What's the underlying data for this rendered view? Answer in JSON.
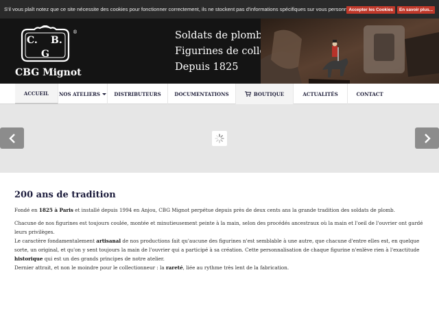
{
  "cookie": {
    "message": "S'il vous plaît notez que ce site nécessite des cookies pour fonctionner correctement, ils ne stockent pas d'informations spécifiques sur vous personnellement",
    "accept_label": "Accepter les Cookies",
    "more_label": "En savoir plus..."
  },
  "header": {
    "logo_letters": [
      "C.",
      "B.",
      "G"
    ],
    "logo_name": "CBG Mignot",
    "tagline": [
      "Soldats de plomb,",
      "Figurines de collection",
      "Depuis 1825"
    ]
  },
  "nav": {
    "items": [
      {
        "label": "Accueil"
      },
      {
        "label": "Nos ateliers"
      },
      {
        "label": "Distributeurs"
      },
      {
        "label": "Documentations"
      },
      {
        "label": "Boutique"
      },
      {
        "label": "Actualités"
      },
      {
        "label": "Contact"
      }
    ],
    "active_index": 0
  },
  "slider": {
    "prev_icon": "chevron-left-icon",
    "next_icon": "chevron-right-icon",
    "loading_icon": "spinner-icon"
  },
  "content": {
    "heading": "200 ans de tradition",
    "p1": {
      "a": "Fondé en ",
      "b": "1825 à Paris",
      "c": " et installé depuis 1994 en Anjou, CBG Mignot perpétue depuis près de deux cents ans la grande tradition des soldats de plomb."
    },
    "p2": "Chacune de nos figurines est toujours coulée, montée et minutieusement peinte à la main, selon des procédés ancestraux où la main et l'oeil de l'ouvrier ont gardé leurs privilèges.",
    "p3": {
      "a": "Le caractère fondamentalement ",
      "b": "artisanal",
      "c": " de nos productions fait qu'aucune des figurines n'est semblable à une autre, que chacune d'entre elles est, en quelque sorte, un original, et qu'on y sent toujours la main de l'ouvrier qui a participé à sa création. Cette personnalisation de chaque figurine n'enlève rien à l'exactitude ",
      "d": "historique",
      "e": " qui est un des grands principes de notre atelier."
    },
    "p4": {
      "a": "Dernier attrait, et non le moindre pour le collectionneur : la ",
      "b": "rareté",
      "c": ", liée au rythme très lent de la fabrication."
    }
  },
  "colors": {
    "cookie_bg": "#2a2a2a",
    "accept_btn": "#c0392b",
    "header_bg": "#141414",
    "nav_text": "#1f1f3a",
    "slider_bg": "#e6e6e6"
  }
}
